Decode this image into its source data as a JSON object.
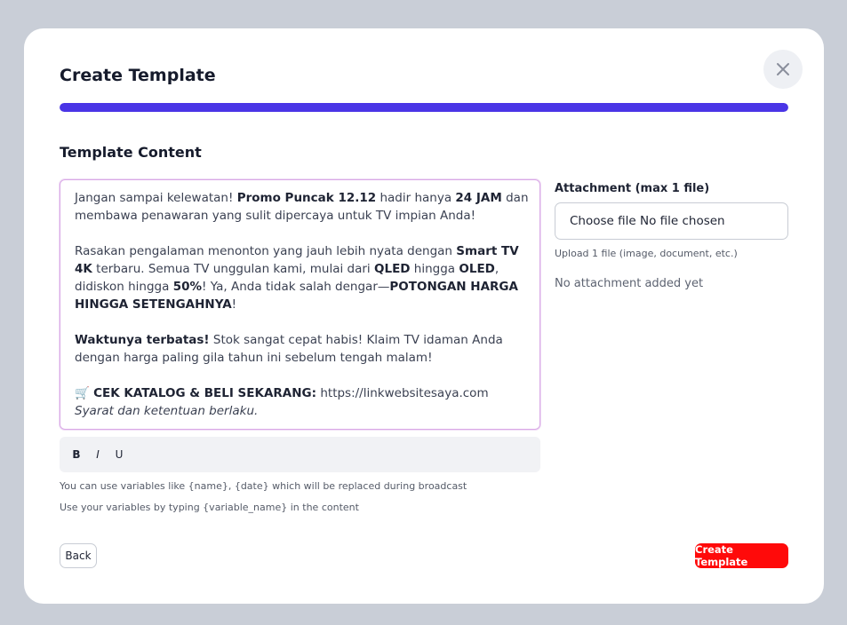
{
  "modal": {
    "title": "Create Template",
    "progress_fraction": 1.0,
    "accent": "#4a35e6"
  },
  "content": {
    "section_title": "Template Content",
    "editor": {
      "p1_a": "Jangan sampai kelewatan! ",
      "p1_b": "Promo Puncak 12.12",
      "p1_c": " hadir hanya ",
      "p1_d": "24 JAM",
      "p1_e": " dan membawa penawaran yang sulit dipercaya untuk TV impian Anda!",
      "p2_a": "Rasakan pengalaman menonton yang jauh lebih nyata dengan ",
      "p2_b": "Smart TV 4K",
      "p2_c": " terbaru. Semua TV unggulan kami, mulai dari ",
      "p2_d": "QLED",
      "p2_e": " hingga ",
      "p2_f": "OLED",
      "p2_g": ", didiskon hingga ",
      "p2_h": "50%",
      "p2_i": "! Ya, Anda tidak salah dengar—",
      "p2_j": "POTONGAN HARGA HINGGA SETENGAHNYA",
      "p2_k": "!",
      "p3_a": "Waktunya terbatas!",
      "p3_b": " Stok sangat cepat habis! Klaim TV idaman Anda dengan harga paling gila tahun ini sebelum tengah malam!",
      "p4_icon": "🛒",
      "p4_a": "CEK KATALOG & BELI SEKARANG:",
      "p4_b": " https://linkwebsitesaya.com",
      "p5": "Syarat dan ketentuan berlaku."
    },
    "toolbar": {
      "bold": "B",
      "italic": "I",
      "underline": "U"
    },
    "help1": "You can use variables like {name}, {date} which will be replaced during broadcast",
    "help2": "Use your variables by typing {variable_name} in the content"
  },
  "attachment": {
    "label": "Attachment (max 1 file)",
    "file_input": "Choose file No file chosen",
    "hint": "Upload 1 file (image, document, etc.)",
    "empty": "No attachment added yet"
  },
  "footer": {
    "back": "Back",
    "create": "Create Template",
    "create_color": "#ff0a0a"
  }
}
